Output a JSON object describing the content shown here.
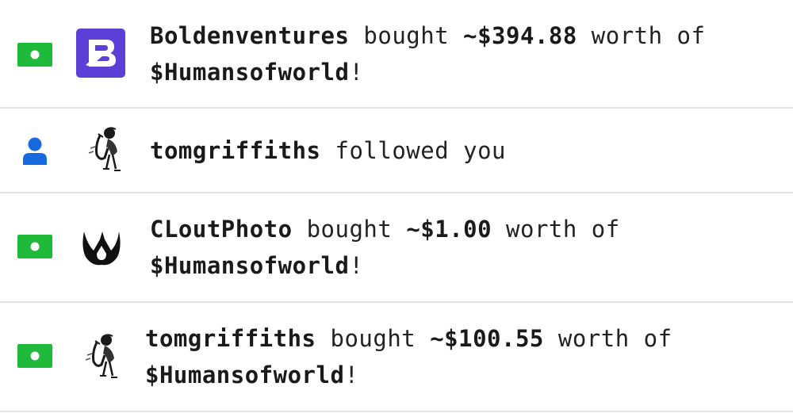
{
  "colors": {
    "money_green": "#1fba3a",
    "person_blue": "#1769e0",
    "bolden_purple": "#5b3fd6",
    "divider": "#e3e3e3",
    "text": "#222222"
  },
  "notifications": [
    {
      "type_icon": "money-icon",
      "avatar": "bolden-logo-avatar",
      "username": "Boldenventures",
      "action": "bought",
      "amount": "~$394.88",
      "connector": "worth of",
      "coin": "$Humansofworld",
      "suffix": "!"
    },
    {
      "type_icon": "person-icon",
      "avatar": "saxophone-player-avatar",
      "username": "tomgriffiths",
      "action": "followed you"
    },
    {
      "type_icon": "money-icon",
      "avatar": "cloutphoto-logo-avatar",
      "username": "CLoutPhoto",
      "action": "bought",
      "amount": "~$1.00",
      "connector": "worth of",
      "coin": "$Humansofworld",
      "suffix": "!"
    },
    {
      "type_icon": "money-icon",
      "avatar": "saxophone-player-avatar",
      "username": "tomgriffiths",
      "action": "bought",
      "amount": "~$100.55",
      "connector": "worth of",
      "coin": "$Humansofworld",
      "suffix": "!"
    }
  ]
}
